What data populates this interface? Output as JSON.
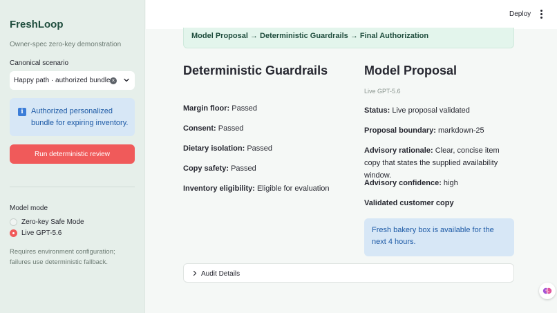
{
  "sidebar": {
    "title": "FreshLoop",
    "subtitle": "Owner-spec zero-key demonstration",
    "scenario_label": "Canonical scenario",
    "scenario_value": "Happy path · authorized bundle",
    "info_text": "Authorized personalized bundle for expiring inventory.",
    "run_button": "Run deterministic review",
    "model_mode_label": "Model mode",
    "model_modes": [
      {
        "label": "Zero-key Safe Mode",
        "selected": false
      },
      {
        "label": "Live GPT-5.6",
        "selected": true
      }
    ],
    "mode_help": "Requires environment configuration; failures use deterministic fallback."
  },
  "header": {
    "deploy_label": "Deploy"
  },
  "main": {
    "flow_banner": "Model Proposal → Deterministic Guardrails → Final Authorization",
    "guardrails": {
      "title": "Deterministic Guardrails",
      "items": [
        {
          "label": "Margin floor:",
          "value": "Passed"
        },
        {
          "label": "Consent:",
          "value": "Passed"
        },
        {
          "label": "Dietary isolation:",
          "value": "Passed"
        },
        {
          "label": "Copy safety:",
          "value": "Passed"
        },
        {
          "label": "Inventory eligibility:",
          "value": "Eligible for evaluation"
        }
      ]
    },
    "proposal": {
      "title": "Model Proposal",
      "caption": "Live GPT-5.6",
      "items": [
        {
          "label": "Status:",
          "value": "Live proposal validated"
        },
        {
          "label": "Proposal boundary:",
          "value": "markdown-25"
        },
        {
          "label": "Advisory rationale:",
          "value": "Clear, concise item copy that states the supplied availability window."
        },
        {
          "label": "Advisory confidence:",
          "value": "high"
        }
      ],
      "copy_heading": "Validated customer copy",
      "copy_text": "Fresh bakery box is available for the next 4 hours."
    },
    "audit_label": "Audit Details"
  },
  "colors": {
    "accent": "#f05a5a",
    "info_bg": "#d7e7f6",
    "info_text": "#1d5aa6",
    "brand": "#1f4d3d"
  }
}
